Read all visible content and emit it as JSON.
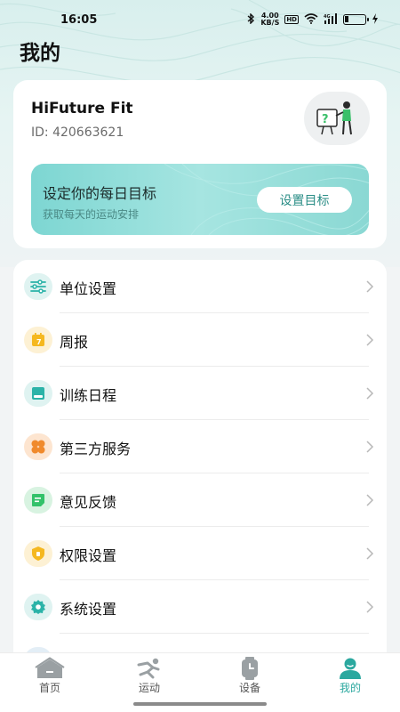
{
  "status_bar": {
    "time": "16:05",
    "network_speed": "4.00",
    "network_unit": "KB/S",
    "hd_label": "HD",
    "signal_label": "4G"
  },
  "page": {
    "title": "我的"
  },
  "profile": {
    "name": "HiFuture Fit",
    "id_text": "ID: 420663621",
    "avatar_icon": "person-with-board-avatar"
  },
  "goal_banner": {
    "title": "设定你的每日目标",
    "subtitle": "获取每天的运动安排",
    "button_label": "设置目标"
  },
  "menu": {
    "items": [
      {
        "label": "单位设置",
        "icon": "sliders-icon",
        "color": "#2bb3a8"
      },
      {
        "label": "周报",
        "icon": "calendar-icon",
        "color": "#f5b820"
      },
      {
        "label": "训练日程",
        "icon": "schedule-icon",
        "color": "#2bb3a8"
      },
      {
        "label": "第三方服务",
        "icon": "grid-flower-icon",
        "color": "#f08a2c"
      },
      {
        "label": "意见反馈",
        "icon": "feedback-icon",
        "color": "#33c26a"
      },
      {
        "label": "权限设置",
        "icon": "shield-icon",
        "color": "#f5b820"
      },
      {
        "label": "系统设置",
        "icon": "gear-icon",
        "color": "#2bb3a8"
      }
    ]
  },
  "tabs": [
    {
      "label": "首页",
      "icon": "home-icon"
    },
    {
      "label": "运动",
      "icon": "running-icon"
    },
    {
      "label": "设备",
      "icon": "watch-icon"
    },
    {
      "label": "我的",
      "icon": "profile-icon",
      "active": true
    }
  ],
  "colors": {
    "accent": "#2ba89f",
    "banner": "#8ad8d3"
  }
}
